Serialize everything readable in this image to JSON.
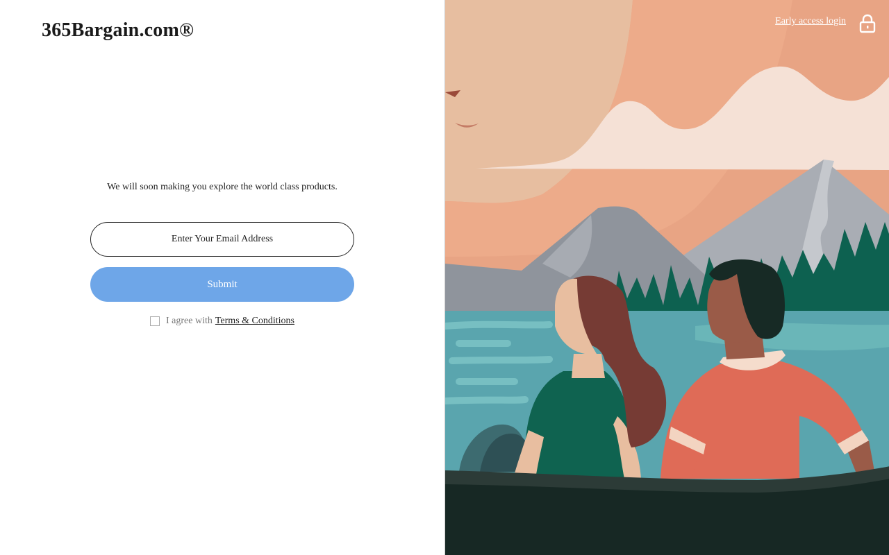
{
  "brand": {
    "logo": "365Bargain.com®"
  },
  "main": {
    "tagline": "We will soon making you explore the world class products.",
    "email_placeholder": "Enter Your Email Address",
    "submit_label": "Submit",
    "agree_prefix": "I agree with",
    "terms_label": "Terms & Conditions",
    "agree_checked": false
  },
  "header": {
    "early_access_label": "Early access login",
    "lock_icon": "lock-icon"
  },
  "colors": {
    "submit_bg": "#6ea6e8",
    "sky": "#efb08f",
    "lake": "#5ea9b2",
    "forest": "#0f6350",
    "boat": "#182a24"
  },
  "illustration": {
    "name": "couple-looking-at-mountain-lake"
  }
}
